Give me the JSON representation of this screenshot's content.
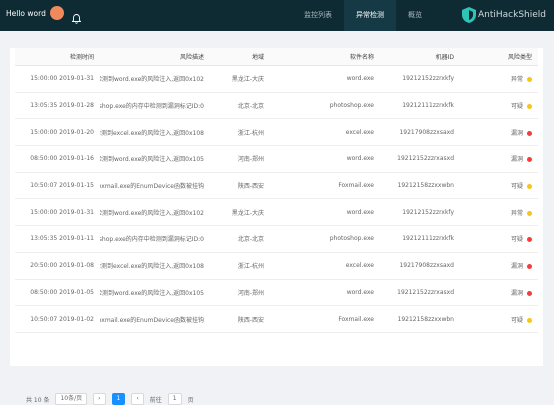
{
  "header": {
    "brand": "AntiHackShield",
    "nav": [
      "概览",
      "异常检测",
      "监控列表"
    ],
    "active_nav_index": 1,
    "user": "Hello word"
  },
  "table": {
    "columns": [
      "风险类型",
      "机器ID",
      "软件名称",
      "地域",
      "风险描述",
      "检测时间"
    ],
    "rows": [
      {
        "status": "异常",
        "color": "#f5c518",
        "id": "19212152zzrxkfy",
        "software": "word.exe",
        "region": "黑龙江-大庆",
        "desc": "检测到word.exe的风险注入,返回0x102",
        "time": "2019-01-31 15:00:00"
      },
      {
        "status": "可疑",
        "color": "#f5c518",
        "id": "19212111zzrxkfk",
        "software": "photoshop.exe",
        "region": "北京-北京",
        "desc": "检测到photoshop.exe的内存中检测到漏洞标记ID:0...",
        "time": "2019-01-28 13:05:35"
      },
      {
        "status": "漏洞",
        "color": "#f53d3d",
        "id": "19217908zzxsaxd",
        "software": "excel.exe",
        "region": "浙江-杭州",
        "desc": "检测到excel.exe的风险注入,返回0x108",
        "time": "2019-01-20 15:00:00"
      },
      {
        "status": "漏洞",
        "color": "#f53d3d",
        "id": "19212152zzrxasxd",
        "software": "word.exe",
        "region": "河南-郑州",
        "desc": "检测到word.exe的风险注入,返回0x105",
        "time": "2019-01-16 08:50:00"
      },
      {
        "status": "可疑",
        "color": "#f5c518",
        "id": "19212158zzxxwbn",
        "software": "Foxmail.exe",
        "region": "陕西-西安",
        "desc": "检测到Foxmail.exe的EnumDevice函数被挂钩",
        "time": "2019-01-15 10:50:07"
      },
      {
        "status": "异常",
        "color": "#f5c518",
        "id": "19212152zzrxkfy",
        "software": "word.exe",
        "region": "黑龙江-大庆",
        "desc": "检测到word.exe的风险注入,返回0x102",
        "time": "2019-01-31 15:00:00"
      },
      {
        "status": "可疑",
        "color": "#f53d3d",
        "id": "19212111zzrxkfk",
        "software": "photoshop.exe",
        "region": "北京-北京",
        "desc": "检测到photoshop.exe的内存中检测到漏洞标记ID:0...",
        "time": "2019-01-11 13:05:35"
      },
      {
        "status": "漏洞",
        "color": "#f53d3d",
        "id": "19217908zzxsaxd",
        "software": "excel.exe",
        "region": "浙江-杭州",
        "desc": "检测到excel.exe的风险注入,返回0x108",
        "time": "2019-01-08 20:50:00"
      },
      {
        "status": "漏洞",
        "color": "#f53d3d",
        "id": "19212152zzrxasxd",
        "software": "word.exe",
        "region": "河南-郑州",
        "desc": "检测到word.exe的风险注入,返回0x105",
        "time": "2019-01-05 08:50:00"
      },
      {
        "status": "可疑",
        "color": "#f5c518",
        "id": "19212158zzxxwbn",
        "software": "Foxmail.exe",
        "region": "陕西-西安",
        "desc": "检测到Foxmail.exe的EnumDevice函数被挂钩",
        "time": "2019-01-02 10:50:07"
      }
    ]
  },
  "pager": {
    "total": "共 10 条",
    "page_size": "10条/页",
    "current": "1",
    "goto_label": "前往",
    "goto_value": "1",
    "page_unit": "页"
  }
}
